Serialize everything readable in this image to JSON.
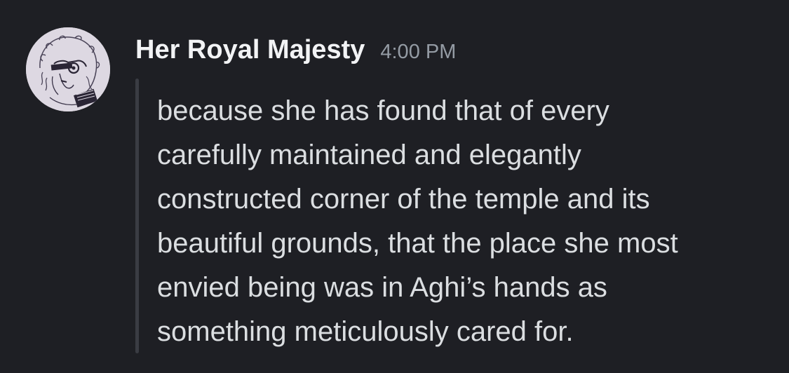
{
  "message": {
    "author": "Her Royal Majesty",
    "timestamp": "4:00 PM",
    "avatar_icon": "user-avatar-illustration",
    "quote_lines": [
      "because she has found that of every",
      "carefully maintained and elegantly",
      "constructed corner of the temple and its",
      "beautiful grounds, that the place she most",
      "envied being was in Aghi’s hands as",
      "something meticulously cared for."
    ]
  },
  "colors": {
    "background": "#1e1f24",
    "username": "#f2f3f5",
    "timestamp": "#949ba4",
    "message_text": "#dbdee1",
    "quote_bar": "#3a3c43"
  }
}
